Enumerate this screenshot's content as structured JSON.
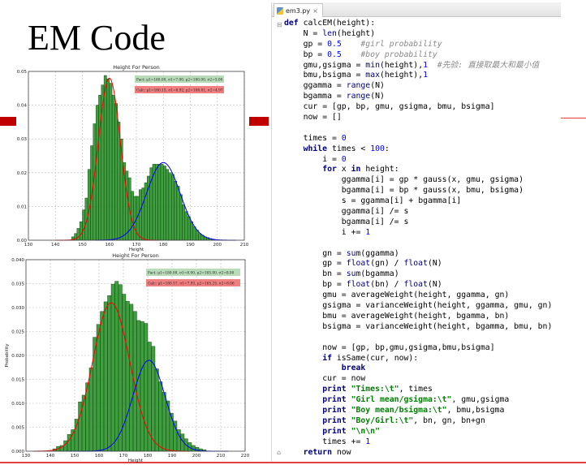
{
  "slide": {
    "title": "EM Code",
    "accent_color": "#c00000"
  },
  "editor": {
    "tab_label": "em3.py",
    "tab_close": "×",
    "code_lines": [
      "def calcEM(height):",
      "    N = len(height)",
      "    gp = 0.5    #girl probability",
      "    bp = 0.5    #boy probability",
      "    gmu,gsigma = min(height),1  #先验: 直接取最大和最小值",
      "    bmu,bsigma = max(height),1",
      "    ggamma = range(N)",
      "    bgamma = range(N)",
      "    cur = [gp, bp, gmu, gsigma, bmu, bsigma]",
      "    now = []",
      "",
      "    times = 0",
      "    while times < 100:",
      "        i = 0",
      "        for x in height:",
      "            ggamma[i] = gp * gauss(x, gmu, gsigma)",
      "            bgamma[i] = bp * gauss(x, bmu, bsigma)",
      "            s = ggamma[i] + bgamma[i]",
      "            ggamma[i] /= s",
      "            bgamma[i] /= s",
      "            i += 1",
      "",
      "        gn = sum(ggamma)",
      "        gp = float(gn) / float(N)",
      "        bn = sum(bgamma)",
      "        bp = float(bn) / float(N)",
      "        gmu = averageWeight(height, ggamma, gn)",
      "        gsigma = varianceWeight(height, ggamma, gmu, gn)",
      "        bmu = averageWeight(height, bgamma, bn)",
      "        bsigma = varianceWeight(height, bgamma, bmu, bn)",
      "",
      "        now = [gp, bp,gmu,gsigma,bmu,bsigma]",
      "        if isSame(cur, now):",
      "            break",
      "        cur = now",
      "        print \"Times:\\t\", times",
      "        print \"Girl mean/gsigma:\\t\", gmu,gsigma",
      "        print \"Boy mean/bsigma:\\t\", bmu,bsigma",
      "        print \"Boy/Girl:\\t\", bn, gn, bn+gn",
      "        print \"\\n\\n\"",
      "        times += 1",
      "    return now"
    ]
  },
  "chart_data": [
    {
      "type": "bar",
      "title": "Height For Person",
      "xlabel": "Height",
      "ylabel": "",
      "xlim": [
        130,
        210
      ],
      "ylim": [
        0,
        0.05
      ],
      "xticks": [
        "130",
        "140",
        "150",
        "160",
        "170",
        "180",
        "190",
        "200",
        "210"
      ],
      "yticks": [
        "0.00",
        "0.01",
        "0.02",
        "0.03",
        "0.04",
        "0.05"
      ],
      "grid": true,
      "bar_width": 1,
      "bar_color": "#1f8c1f",
      "bars_x": [
        146,
        147,
        148,
        149,
        150,
        151,
        152,
        153,
        154,
        155,
        156,
        157,
        158,
        159,
        160,
        161,
        162,
        163,
        164,
        165,
        166,
        167,
        168,
        169,
        170,
        171,
        172,
        173,
        174,
        175,
        176,
        177,
        178,
        179,
        180,
        181,
        182,
        183,
        184,
        185,
        186,
        187,
        188,
        189,
        190,
        191,
        192,
        193,
        194,
        195,
        196,
        197,
        198
      ],
      "bars_y": [
        0.001,
        0.002,
        0.0035,
        0.0055,
        0.009,
        0.0125,
        0.021,
        0.028,
        0.0345,
        0.04,
        0.043,
        0.046,
        0.0488,
        0.0478,
        0.0465,
        0.043,
        0.0405,
        0.035,
        0.03,
        0.023,
        0.0205,
        0.0185,
        0.0145,
        0.013,
        0.013,
        0.015,
        0.0155,
        0.017,
        0.019,
        0.0215,
        0.0225,
        0.0225,
        0.0225,
        0.0225,
        0.022,
        0.021,
        0.02,
        0.0195,
        0.0175,
        0.016,
        0.0135,
        0.0105,
        0.0085,
        0.007,
        0.0055,
        0.004,
        0.003,
        0.002,
        0.0015,
        0.001,
        0.0008,
        0.0005,
        0.0003
      ],
      "curves": [
        {
          "color": "#ff0000",
          "mu": 160,
          "sigma": 4.1,
          "peak": 0.048,
          "range": [
            140,
            178
          ]
        },
        {
          "color": "#0000ff",
          "mu": 180,
          "sigma": 6.2,
          "peak": 0.023,
          "range": [
            155,
            207
          ]
        }
      ],
      "legend": [
        {
          "text": "Fact: μ1=160.00, σ1=7.00, μ2=180.00, σ2=5.00",
          "color": "#b8dcb8"
        },
        {
          "text": "Calc: μ1=160.15, σ1=6.92, μ2=180.01, σ2=4.97",
          "color": "#f08080"
        }
      ]
    },
    {
      "type": "bar",
      "title": "Height For Person",
      "xlabel": "Height",
      "ylabel": "Probability",
      "xlim": [
        130,
        220
      ],
      "ylim": [
        0,
        0.04
      ],
      "xticks": [
        "130",
        "140",
        "150",
        "160",
        "170",
        "180",
        "190",
        "200",
        "210",
        "220"
      ],
      "yticks": [
        "0.000",
        "0.005",
        "0.010",
        "0.015",
        "0.020",
        "0.025",
        "0.030",
        "0.035",
        "0.040"
      ],
      "grid": true,
      "bar_width": 1.5,
      "bar_color": "#1f8c1f",
      "bars_x": [
        141,
        142.5,
        144,
        145.5,
        147,
        148.5,
        150,
        151.5,
        153,
        154.5,
        156,
        157.5,
        159,
        160.5,
        162,
        163.5,
        165,
        166.5,
        168,
        169.5,
        171,
        172.5,
        174,
        175.5,
        177,
        178.5,
        180,
        181.5,
        183,
        184.5,
        186,
        187.5,
        189,
        190.5,
        192,
        193.5,
        195,
        196.5,
        198,
        199.5,
        201,
        202.5
      ],
      "bars_y": [
        0.0005,
        0.001,
        0.0012,
        0.0022,
        0.0035,
        0.0045,
        0.0067,
        0.0103,
        0.0117,
        0.0143,
        0.0174,
        0.0238,
        0.0265,
        0.0292,
        0.0312,
        0.0325,
        0.0349,
        0.0355,
        0.0348,
        0.0328,
        0.0313,
        0.0307,
        0.0292,
        0.0273,
        0.0271,
        0.0267,
        0.0228,
        0.0219,
        0.0172,
        0.0145,
        0.0123,
        0.0105,
        0.0079,
        0.0063,
        0.0045,
        0.0036,
        0.0026,
        0.0018,
        0.0012,
        0.0008,
        0.0005,
        0.0003
      ],
      "curves": [
        {
          "color": "#ff0000",
          "mu": 165,
          "sigma": 7.6,
          "peak": 0.031,
          "range": [
            133,
            197
          ]
        },
        {
          "color": "#0000ff",
          "mu": 180.5,
          "sigma": 6.6,
          "peak": 0.019,
          "range": [
            148,
            213
          ]
        }
      ],
      "legend": [
        {
          "text": "Fact: μ1=180.00, σ1=8.00, μ2=165.00, σ2=8.00",
          "color": "#b8dcb8"
        },
        {
          "text": "Calc: μ1=180.57, σ1=7.93, μ2=165.25, σ2=8.06",
          "color": "#f08080"
        }
      ]
    }
  ]
}
